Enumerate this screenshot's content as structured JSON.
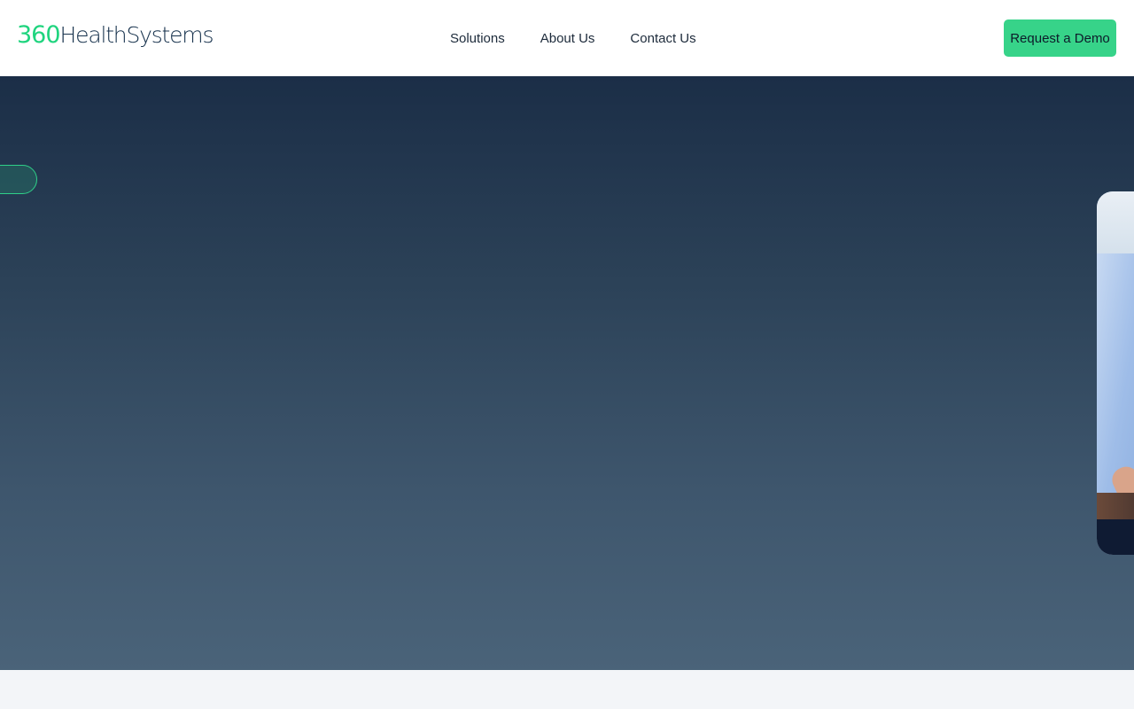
{
  "brand": {
    "logo_number": "360",
    "logo_text": "HealthSystems",
    "accent_color": "#1fd47e",
    "navy_color": "#17324d"
  },
  "nav": {
    "items": [
      {
        "label": "Solutions"
      },
      {
        "label": "About Us"
      },
      {
        "label": "Contact Us"
      }
    ]
  },
  "header": {
    "cta_label": "Request a Demo",
    "cta_color": "#37d389"
  },
  "hero": {
    "background_top": "#1b2e47",
    "background_bottom": "#4a6379",
    "photo_description_icon": "person-photo"
  }
}
